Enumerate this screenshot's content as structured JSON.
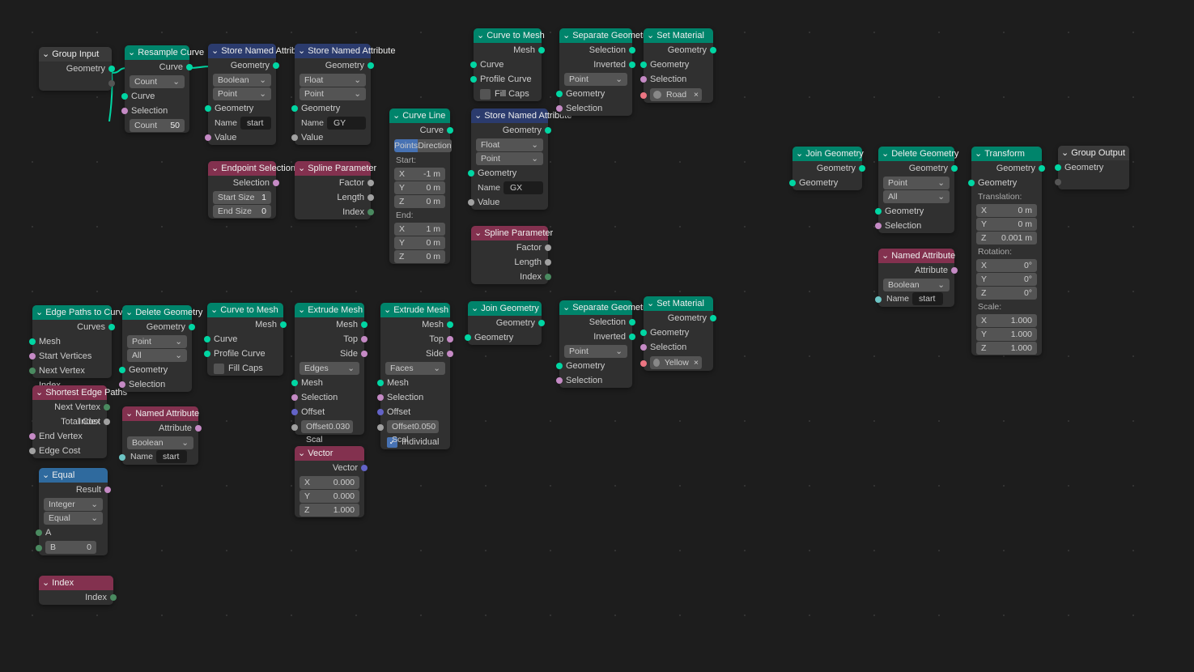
{
  "group_input": {
    "title": "Group Input",
    "out_geo": "Geometry"
  },
  "resample_curve": {
    "title": "Resample Curve",
    "out_curve": "Curve",
    "mode": "Count",
    "in_curve": "Curve",
    "in_selection": "Selection",
    "count_label": "Count",
    "count_val": "50"
  },
  "store_attr1": {
    "title": "Store Named Attribute",
    "out_geo": "Geometry",
    "type": "Boolean",
    "domain": "Point",
    "in_geo": "Geometry",
    "name_label": "Name",
    "name_val": "start",
    "in_value": "Value"
  },
  "store_attr2": {
    "title": "Store Named Attribute",
    "out_geo": "Geometry",
    "type": "Float",
    "domain": "Point",
    "in_geo": "Geometry",
    "name_label": "Name",
    "name_val": "GY",
    "in_value": "Value"
  },
  "store_attr3": {
    "title": "Store Named Attribute",
    "out_geo": "Geometry",
    "type": "Float",
    "domain": "Point",
    "in_geo": "Geometry",
    "name_label": "Name",
    "name_val": "GX",
    "in_value": "Value"
  },
  "endpoint_sel": {
    "title": "Endpoint Selection",
    "out_sel": "Selection",
    "start_label": "Start Size",
    "start_val": "1",
    "end_label": "End Size",
    "end_val": "0"
  },
  "spline_param1": {
    "title": "Spline Parameter",
    "out_factor": "Factor",
    "out_length": "Length",
    "out_index": "Index"
  },
  "spline_param2": {
    "title": "Spline Parameter",
    "out_factor": "Factor",
    "out_length": "Length",
    "out_index": "Index"
  },
  "curve_line": {
    "title": "Curve Line",
    "out_curve": "Curve",
    "mode_points": "Points",
    "mode_dir": "Direction",
    "start_label": "Start:",
    "end_label": "End:",
    "x": "X",
    "y": "Y",
    "z": "Z",
    "sx": "-1 m",
    "sy": "0 m",
    "sz": "0 m",
    "ex": "1 m",
    "ey": "0 m",
    "ez": "0 m"
  },
  "curve_to_mesh1": {
    "title": "Curve to Mesh",
    "out_mesh": "Mesh",
    "in_curve": "Curve",
    "in_profile": "Profile Curve",
    "fill_caps": "Fill Caps"
  },
  "curve_to_mesh2": {
    "title": "Curve to Mesh",
    "out_mesh": "Mesh",
    "in_curve": "Curve",
    "in_profile": "Profile Curve",
    "fill_caps": "Fill Caps"
  },
  "separate1": {
    "title": "Separate Geometry",
    "out_sel": "Selection",
    "out_inv": "Inverted",
    "domain": "Point",
    "in_geo": "Geometry",
    "in_sel": "Selection"
  },
  "separate2": {
    "title": "Separate Geometry",
    "out_sel": "Selection",
    "out_inv": "Inverted",
    "domain": "Point",
    "in_geo": "Geometry",
    "in_sel": "Selection"
  },
  "set_mat1": {
    "title": "Set Material",
    "out_geo": "Geometry",
    "in_geo": "Geometry",
    "in_sel": "Selection",
    "mat": "Road"
  },
  "set_mat2": {
    "title": "Set Material",
    "out_geo": "Geometry",
    "in_geo": "Geometry",
    "in_sel": "Selection",
    "mat": "Yellow"
  },
  "edge_paths": {
    "title": "Edge Paths to Curves",
    "out_curves": "Curves",
    "in_mesh": "Mesh",
    "in_start": "Start Vertices",
    "in_next": "Next Vertex Index"
  },
  "shortest": {
    "title": "Shortest Edge Paths",
    "out_next": "Next Vertex Index",
    "out_cost": "Total Cost",
    "in_end": "End Vertex",
    "in_edge": "Edge Cost"
  },
  "equal": {
    "title": "Equal",
    "out_result": "Result",
    "type": "Integer",
    "op": "Equal",
    "in_a": "A",
    "b_label": "B",
    "b_val": "0"
  },
  "index": {
    "title": "Index",
    "out_index": "Index"
  },
  "delete1": {
    "title": "Delete Geometry",
    "out_geo": "Geometry",
    "domain": "Point",
    "mode": "All",
    "in_geo": "Geometry",
    "in_sel": "Selection"
  },
  "delete2": {
    "title": "Delete Geometry",
    "out_geo": "Geometry",
    "domain": "Point",
    "mode": "All",
    "in_geo": "Geometry",
    "in_sel": "Selection"
  },
  "named_attr1": {
    "title": "Named Attribute",
    "out_attr": "Attribute",
    "type": "Boolean",
    "name_label": "Name",
    "name_val": "start"
  },
  "named_attr2": {
    "title": "Named Attribute",
    "out_attr": "Attribute",
    "type": "Boolean",
    "name_label": "Name",
    "name_val": "start"
  },
  "extrude1": {
    "title": "Extrude Mesh",
    "out_mesh": "Mesh",
    "out_top": "Top",
    "out_side": "Side",
    "mode": "Edges",
    "in_mesh": "Mesh",
    "in_sel": "Selection",
    "in_offset": "Offset",
    "scale_label": "Offset Scal",
    "scale_val": "0.030"
  },
  "extrude2": {
    "title": "Extrude Mesh",
    "out_mesh": "Mesh",
    "out_top": "Top",
    "out_side": "Side",
    "mode": "Faces",
    "in_mesh": "Mesh",
    "in_sel": "Selection",
    "in_offset": "Offset",
    "scale_label": "Offset Scal",
    "scale_val": "0.050",
    "individual": "Individual"
  },
  "vector": {
    "title": "Vector",
    "out_vec": "Vector",
    "x": "X",
    "y": "Y",
    "z": "Z",
    "vx": "0.000",
    "vy": "0.000",
    "vz": "1.000"
  },
  "join1": {
    "title": "Join Geometry",
    "out_geo": "Geometry",
    "in_geo": "Geometry"
  },
  "join2": {
    "title": "Join Geometry",
    "out_geo": "Geometry",
    "in_geo": "Geometry"
  },
  "transform": {
    "title": "Transform",
    "out_geo": "Geometry",
    "in_geo": "Geometry",
    "trans_label": "Translation:",
    "rot_label": "Rotation:",
    "scale_label": "Scale:",
    "x": "X",
    "y": "Y",
    "z": "Z",
    "tx": "0 m",
    "ty": "0 m",
    "tz": "0.001 m",
    "rx": "0°",
    "ry": "0°",
    "rz": "0°",
    "sx": "1.000",
    "sy": "1.000",
    "sz": "1.000"
  },
  "group_output": {
    "title": "Group Output",
    "in_geo": "Geometry"
  }
}
